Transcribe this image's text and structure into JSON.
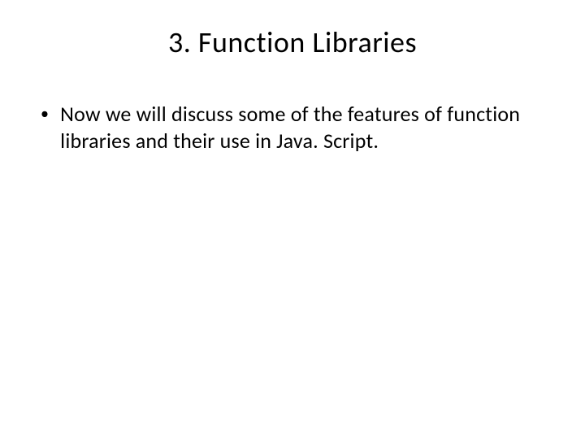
{
  "slide": {
    "title": "3. Function Libraries",
    "bullets": [
      {
        "text": "Now we will discuss some of the features of function libraries and their use in Java. Script."
      }
    ]
  }
}
